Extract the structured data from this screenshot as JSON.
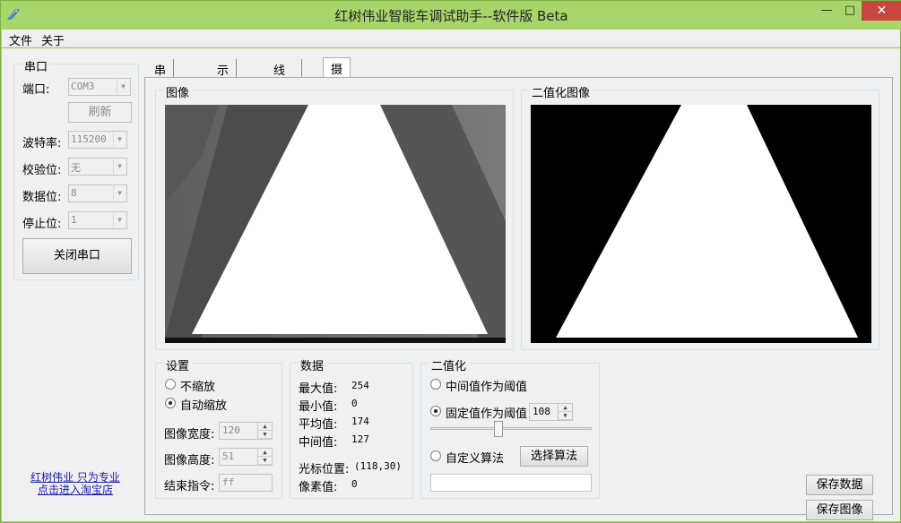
{
  "window": {
    "title": "红树伟业智能车调试助手--软件版 Beta",
    "minimize": "—",
    "maximize": "□",
    "close": "✕"
  },
  "menu": [
    "文件",
    "关于"
  ],
  "serial": {
    "group_title": "串口",
    "port_label": "端口:",
    "port_value": "COM3",
    "refresh_button": "刷新",
    "baud_label": "波特率:",
    "baud_value": "115200",
    "parity_label": "校验位:",
    "parity_value": "无",
    "databits_label": "数据位:",
    "databits_value": "8",
    "stopbits_label": "停止位:",
    "stopbits_value": "1",
    "close_port_button": "关闭串口"
  },
  "link": {
    "line1": "红树伟业 只为专业",
    "line2": "点击进入淘宝店"
  },
  "tabs": [
    "串口助手",
    "示波器",
    "线性ccd",
    "摄像头"
  ],
  "image_group": {
    "title": "图像"
  },
  "binary_group": {
    "title": "二值化图像"
  },
  "settings": {
    "title": "设置",
    "no_scale": "不缩放",
    "auto_scale": "自动缩放",
    "width_label": "图像宽度:",
    "width_value": "120",
    "height_label": "图像高度:",
    "height_value": "51",
    "end_cmd_label": "结束指令:",
    "end_cmd_value": "ff"
  },
  "data": {
    "title": "数据",
    "max_label": "最大值:",
    "max_value": "254",
    "min_label": "最小值:",
    "min_value": "0",
    "avg_label": "平均值:",
    "avg_value": "174",
    "mid_label": "中间值:",
    "mid_value": "127",
    "cursor_label": "光标位置:",
    "cursor_value": "(118,30)",
    "pixel_label": "像素值:",
    "pixel_value": "0"
  },
  "binarize": {
    "title": "二值化",
    "mid_threshold": "中间值作为阈值",
    "fixed_threshold": "固定值作为阈值",
    "fixed_value": "108",
    "custom_algo": "自定义算法",
    "choose_algo_button": "选择算法",
    "algo_field": ""
  },
  "actions": {
    "save_data": "保存数据",
    "save_image": "保存图像"
  }
}
